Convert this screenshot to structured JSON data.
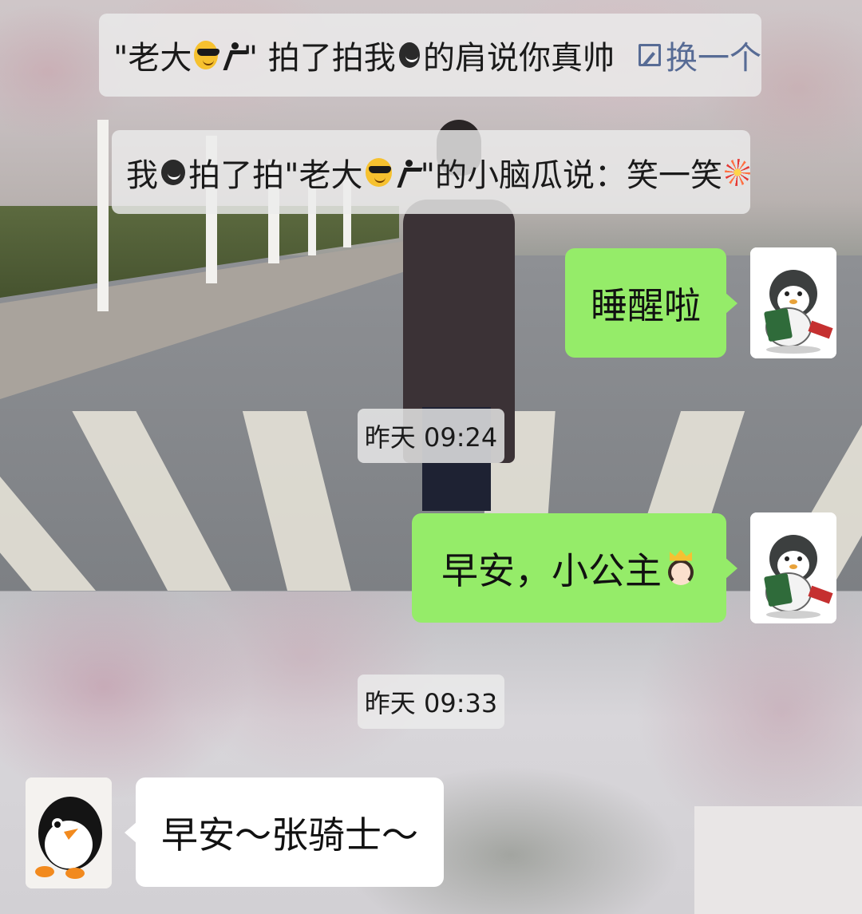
{
  "notices": [
    {
      "prefix": "\"老大",
      "mid1": "\" 拍了拍我",
      "suffix": "的肩说你真帅",
      "action_label": "换一个"
    },
    {
      "prefix": "我",
      "mid1": "拍了拍\"老大",
      "mid2": "\"的小脑瓜说：笑一笑"
    }
  ],
  "messages": [
    {
      "side": "sent",
      "text": "睡醒啦"
    },
    {
      "timestamp": "昨天 09:24"
    },
    {
      "side": "sent",
      "text": "早安，小公主"
    },
    {
      "timestamp": "昨天 09:33"
    },
    {
      "side": "received",
      "text": "早安～张骑士～"
    }
  ],
  "icons": {
    "emoji_cool": "sunglasses-emoji-icon",
    "emoji_dance": "dancing-person-emoji-icon",
    "emoji_smile": "dark-smile-emoji-icon",
    "emoji_fireworks": "fireworks-emoji-icon",
    "emoji_princess": "princess-emoji-icon",
    "edit": "edit-icon"
  },
  "colors": {
    "sent_bubble": "#95ec69",
    "received_bubble": "#ffffff",
    "action_link": "#576b95",
    "system_notice_bg": "#ebebeb"
  }
}
